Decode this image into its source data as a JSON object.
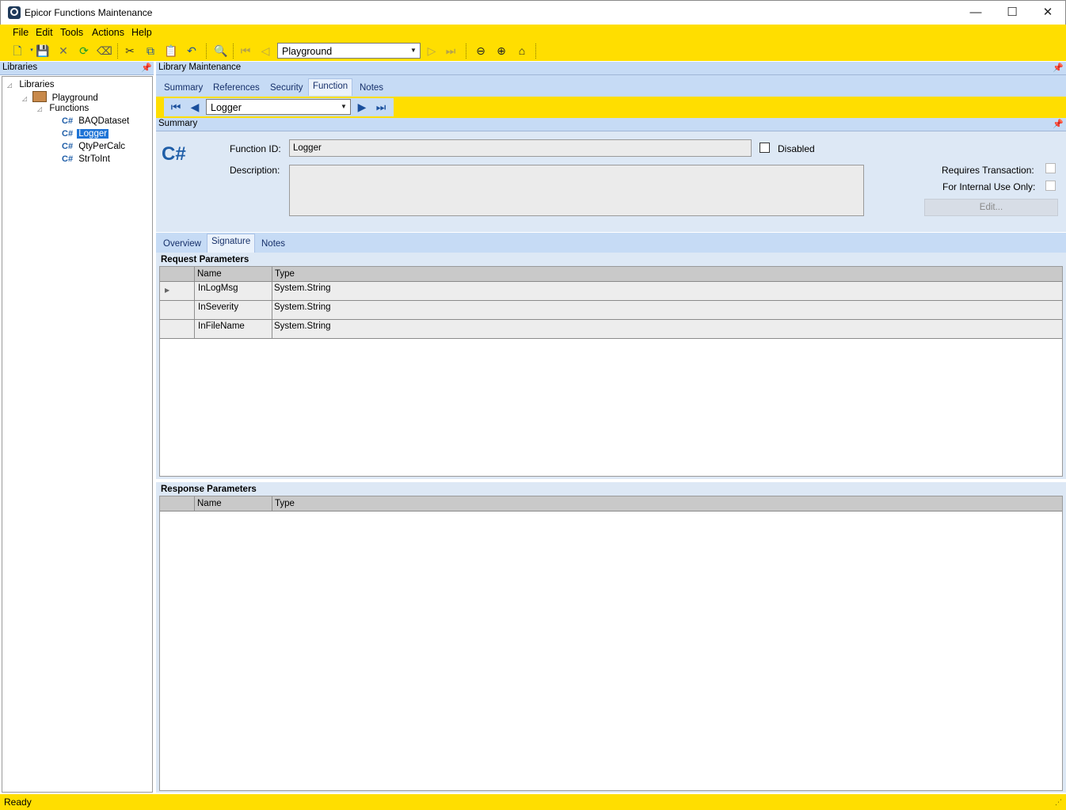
{
  "window": {
    "title": "Epicor Functions Maintenance",
    "minimize": "—",
    "maximize": "☐",
    "close": "✕"
  },
  "menu": [
    "File",
    "Edit",
    "Tools",
    "Actions",
    "Help"
  ],
  "toolbar": {
    "library_combo": "Playground"
  },
  "left_pane": {
    "title": "Libraries",
    "tree": {
      "root": "Libraries",
      "library": "Playground",
      "folder": "Functions",
      "functions": [
        "BAQDataset",
        "Logger",
        "QtyPerCalc",
        "StrToInt"
      ],
      "selected": "Logger",
      "fn_icon": "C#"
    }
  },
  "main": {
    "title": "Library Maintenance",
    "tabs": [
      "Summary",
      "References",
      "Security",
      "Function",
      "Notes"
    ],
    "active_tab": "Function",
    "function_combo": "Logger",
    "summary": {
      "title": "Summary",
      "icon": "C#",
      "function_id_label": "Function ID:",
      "function_id": "Logger",
      "disabled_label": "Disabled",
      "description_label": "Description:",
      "description": "",
      "requires_transaction_label": "Requires Transaction:",
      "internal_use_label": "For Internal Use Only:",
      "edit_button": "Edit..."
    },
    "sub_tabs": [
      "Overview",
      "Signature",
      "Notes"
    ],
    "active_sub_tab": "Signature",
    "request": {
      "title": "Request Parameters",
      "columns": [
        "Name",
        "Type"
      ],
      "rows": [
        {
          "name": "InLogMsg",
          "type": "System.String"
        },
        {
          "name": "InSeverity",
          "type": "System.String"
        },
        {
          "name": "InFileName",
          "type": "System.String"
        }
      ]
    },
    "response": {
      "title": "Response Parameters",
      "columns": [
        "Name",
        "Type"
      ],
      "rows": []
    }
  },
  "status": {
    "text": "Ready"
  },
  "colors": {
    "accent_yellow": "#ffde00",
    "panel_blue": "#c6dbf5",
    "selection": "#1e74d6"
  }
}
